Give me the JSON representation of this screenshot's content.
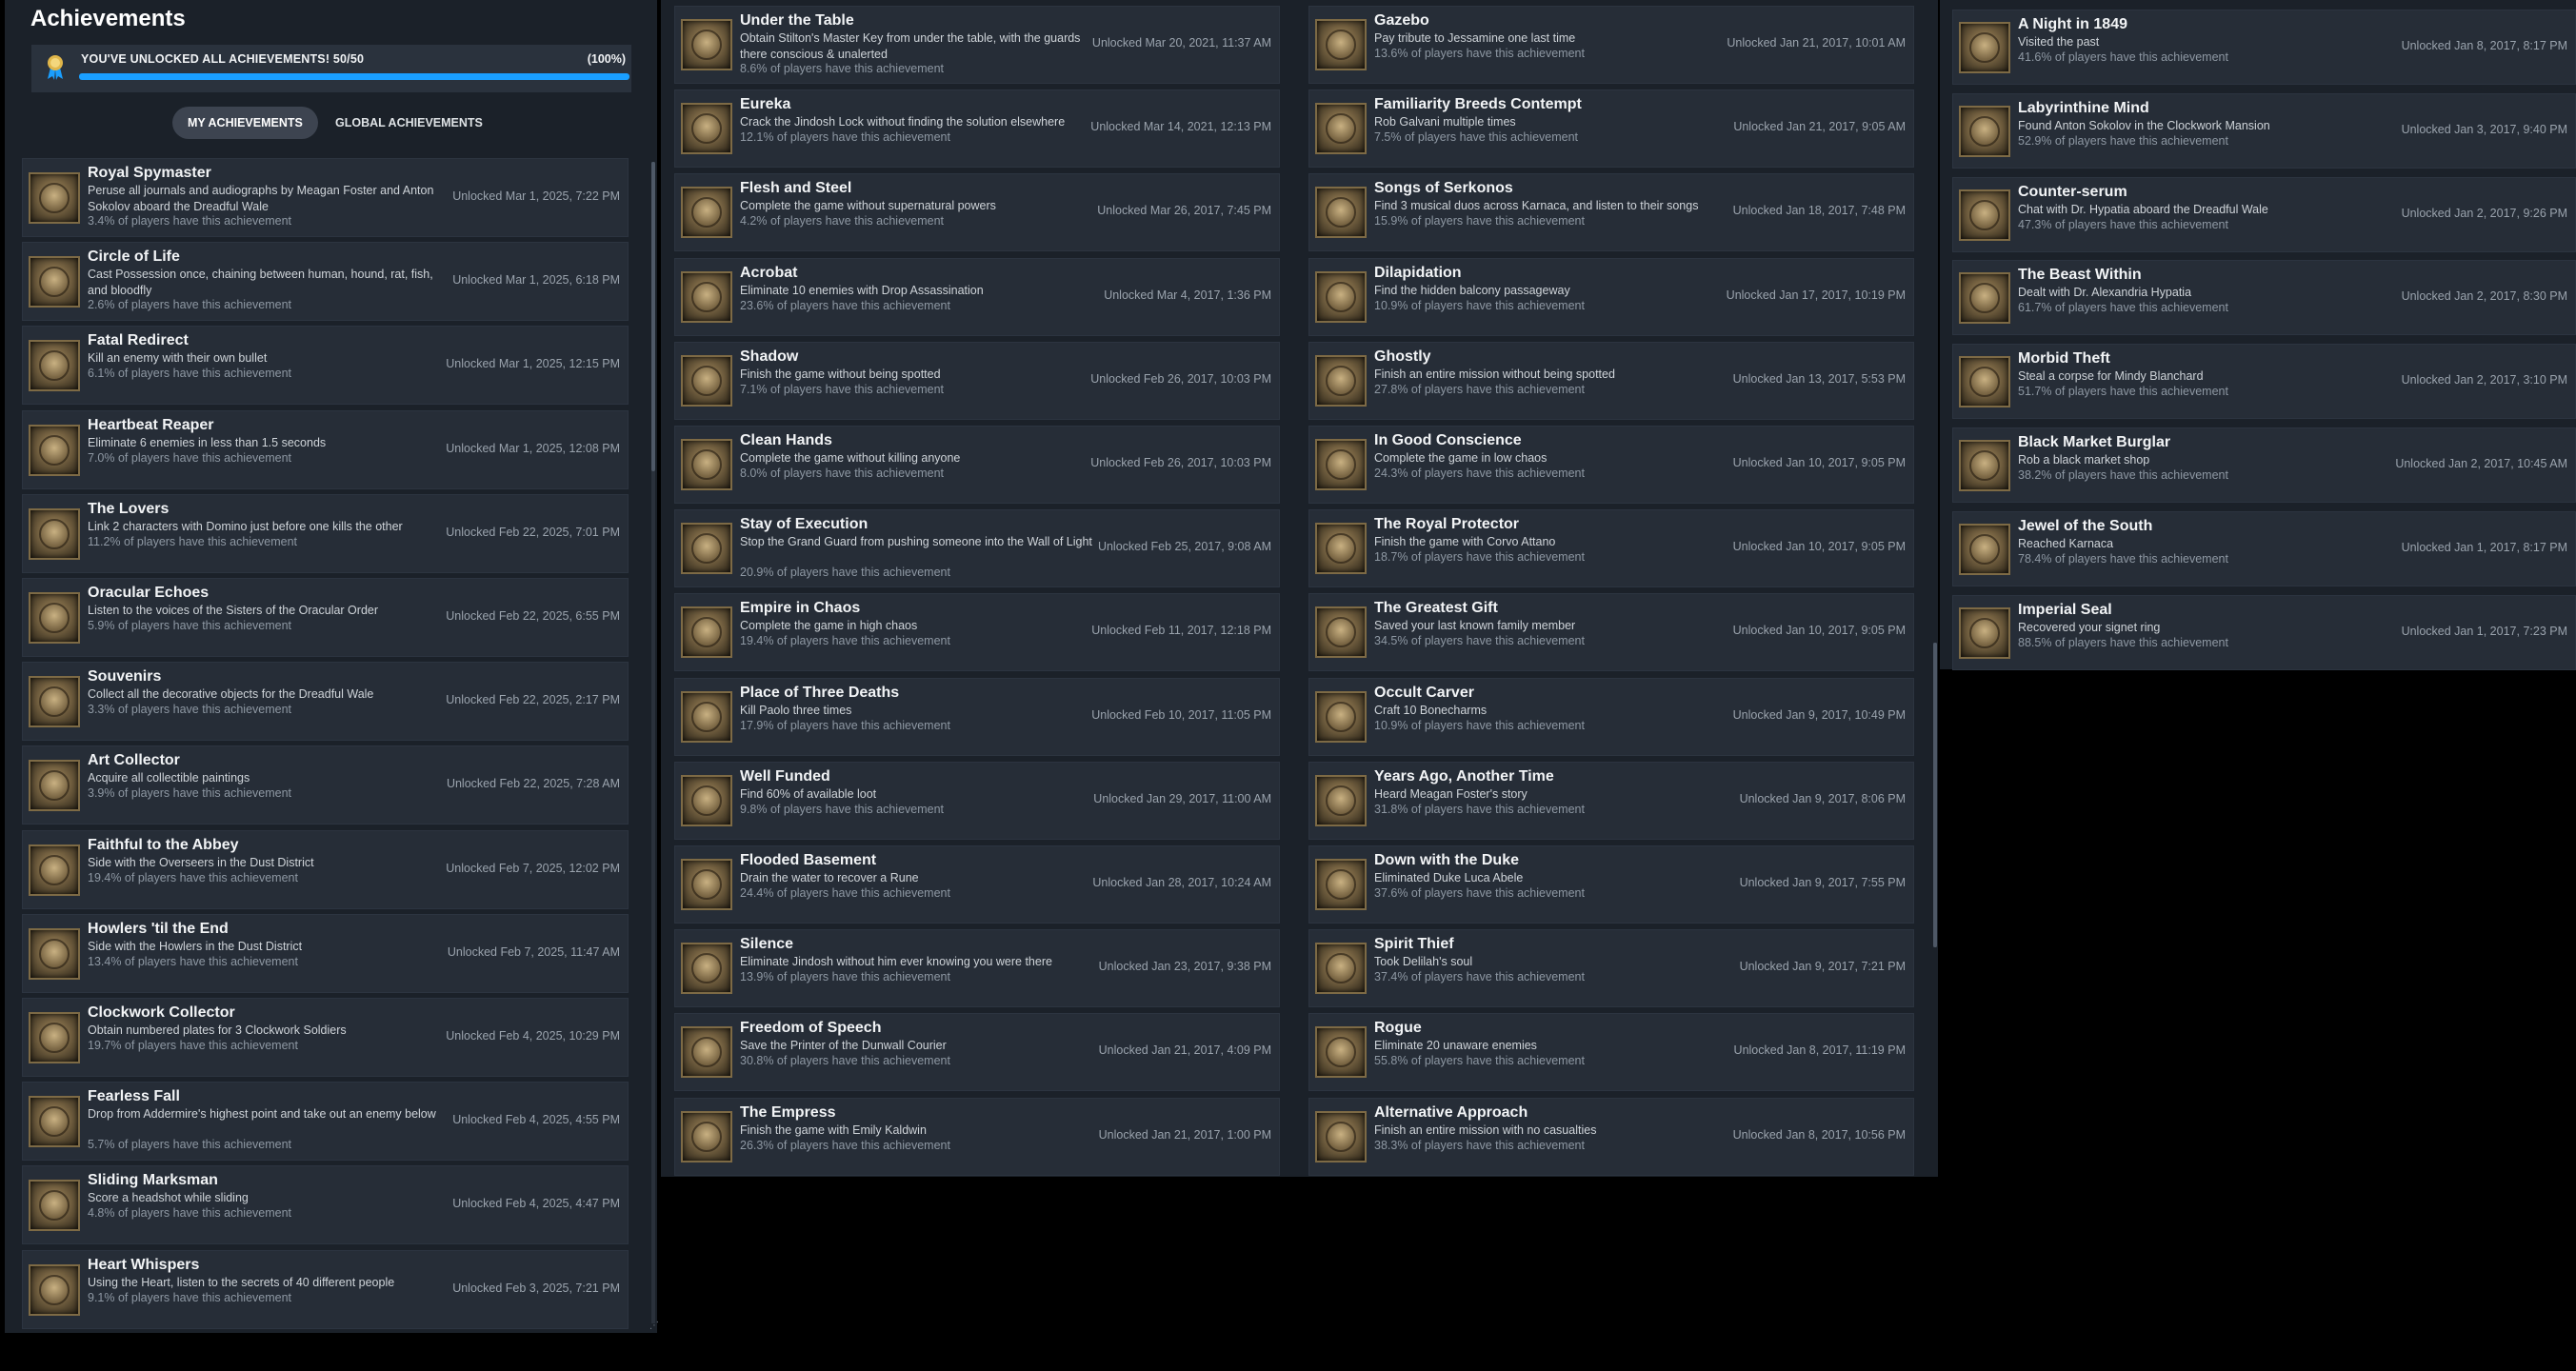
{
  "header": {
    "title": "Achievements",
    "unlock_summary": "YOU'VE UNLOCKED ALL ACHIEVEMENTS! 50/50",
    "unlock_percent": "(100%)",
    "progress_fraction": 1.0,
    "accent_color": "#1a9fff",
    "award_icon": "award-ribbon-icon"
  },
  "tabs": {
    "my": "MY ACHIEVEMENTS",
    "global": "GLOBAL ACHIEVEMENTS",
    "active": "my"
  },
  "columns": [
    [
      {
        "title": "Royal Spymaster",
        "desc": "Peruse all journals and audiographs by Meagan Foster and Anton Sokolov aboard the Dreadful Wale",
        "pct": "3.4% of players have this achievement",
        "date": "Unlocked Mar 1, 2025, 7:22 PM"
      },
      {
        "title": "Circle of Life",
        "desc": "Cast Possession once, chaining between human, hound, rat, fish, and bloodfly",
        "pct": "2.6% of players have this achievement",
        "date": "Unlocked Mar 1, 2025, 6:18 PM"
      },
      {
        "title": "Fatal Redirect",
        "desc": "Kill an enemy with their own bullet",
        "pct": "6.1% of players have this achievement",
        "date": "Unlocked Mar 1, 2025, 12:15 PM"
      },
      {
        "title": "Heartbeat Reaper",
        "desc": "Eliminate 6 enemies in less than 1.5 seconds",
        "pct": "7.0% of players have this achievement",
        "date": "Unlocked Mar 1, 2025, 12:08 PM"
      },
      {
        "title": "The Lovers",
        "desc": "Link 2 characters with Domino just before one kills the other",
        "pct": "11.2% of players have this achievement",
        "date": "Unlocked Feb 22, 2025, 7:01 PM"
      },
      {
        "title": "Oracular Echoes",
        "desc": "Listen to the voices of the Sisters of the Oracular Order",
        "pct": "5.9% of players have this achievement",
        "date": "Unlocked Feb 22, 2025, 6:55 PM"
      },
      {
        "title": "Souvenirs",
        "desc": "Collect all the decorative objects for the Dreadful Wale",
        "pct": "3.3% of players have this achievement",
        "date": "Unlocked Feb 22, 2025, 2:17 PM"
      },
      {
        "title": "Art Collector",
        "desc": "Acquire all collectible paintings",
        "pct": "3.9% of players have this achievement",
        "date": "Unlocked Feb 22, 2025, 7:28 AM"
      },
      {
        "title": "Faithful to the Abbey",
        "desc": "Side with the Overseers in the Dust District",
        "pct": "19.4% of players have this achievement",
        "date": "Unlocked Feb 7, 2025, 12:02 PM"
      },
      {
        "title": "Howlers 'til the End",
        "desc": "Side with the Howlers in the Dust District",
        "pct": "13.4% of players have this achievement",
        "date": "Unlocked Feb 7, 2025, 11:47 AM"
      },
      {
        "title": "Clockwork Collector",
        "desc": "Obtain numbered plates for 3 Clockwork Soldiers",
        "pct": "19.7% of players have this achievement",
        "date": "Unlocked Feb 4, 2025, 10:29 PM"
      },
      {
        "title": "Fearless Fall",
        "desc": "Drop from Addermire's highest point and take out an enemy below",
        "pct": "5.7% of players have this achievement",
        "date": "Unlocked Feb 4, 2025, 4:55 PM"
      },
      {
        "title": "Sliding Marksman",
        "desc": "Score a headshot while sliding",
        "pct": "4.8% of players have this achievement",
        "date": "Unlocked Feb 4, 2025, 4:47 PM"
      },
      {
        "title": "Heart Whispers",
        "desc": "Using the Heart, listen to the secrets of 40 different people",
        "pct": "9.1% of players have this achievement",
        "date": "Unlocked Feb 3, 2025, 7:21 PM"
      }
    ],
    [
      {
        "title": "Under the Table",
        "desc": "Obtain Stilton's Master Key from under the table, with the guards there conscious & unalerted",
        "pct": "8.6% of players have this achievement",
        "date": "Unlocked Mar 20, 2021, 11:37 AM"
      },
      {
        "title": "Eureka",
        "desc": "Crack the Jindosh Lock without finding the solution elsewhere",
        "pct": "12.1% of players have this achievement",
        "date": "Unlocked Mar 14, 2021, 12:13 PM"
      },
      {
        "title": "Flesh and Steel",
        "desc": "Complete the game without supernatural powers",
        "pct": "4.2% of players have this achievement",
        "date": "Unlocked Mar 26, 2017, 7:45 PM"
      },
      {
        "title": "Acrobat",
        "desc": "Eliminate 10 enemies with Drop Assassination",
        "pct": "23.6% of players have this achievement",
        "date": "Unlocked Mar 4, 2017, 1:36 PM"
      },
      {
        "title": "Shadow",
        "desc": "Finish the game without being spotted",
        "pct": "7.1% of players have this achievement",
        "date": "Unlocked Feb 26, 2017, 10:03 PM"
      },
      {
        "title": "Clean Hands",
        "desc": "Complete the game without killing anyone",
        "pct": "8.0% of players have this achievement",
        "date": "Unlocked Feb 26, 2017, 10:03 PM"
      },
      {
        "title": "Stay of Execution",
        "desc": "Stop the Grand Guard from pushing someone into the Wall of Light",
        "pct": "20.9% of players have this achievement",
        "date": "Unlocked Feb 25, 2017, 9:08 AM"
      },
      {
        "title": "Empire in Chaos",
        "desc": "Complete the game in high chaos",
        "pct": "19.4% of players have this achievement",
        "date": "Unlocked Feb 11, 2017, 12:18 PM"
      },
      {
        "title": "Place of Three Deaths",
        "desc": "Kill Paolo three times",
        "pct": "17.9% of players have this achievement",
        "date": "Unlocked Feb 10, 2017, 11:05 PM"
      },
      {
        "title": "Well Funded",
        "desc": "Find 60% of available loot",
        "pct": "9.8% of players have this achievement",
        "date": "Unlocked Jan 29, 2017, 11:00 AM"
      },
      {
        "title": "Flooded Basement",
        "desc": "Drain the water to recover a Rune",
        "pct": "24.4% of players have this achievement",
        "date": "Unlocked Jan 28, 2017, 10:24 AM"
      },
      {
        "title": "Silence",
        "desc": "Eliminate Jindosh without him ever knowing you were there",
        "pct": "13.9% of players have this achievement",
        "date": "Unlocked Jan 23, 2017, 9:38 PM"
      },
      {
        "title": "Freedom of Speech",
        "desc": "Save the Printer of the Dunwall Courier",
        "pct": "30.8% of players have this achievement",
        "date": "Unlocked Jan 21, 2017, 4:09 PM"
      },
      {
        "title": "The Empress",
        "desc": "Finish the game with Emily Kaldwin",
        "pct": "26.3% of players have this achievement",
        "date": "Unlocked Jan 21, 2017, 1:00 PM"
      }
    ],
    [
      {
        "title": "Gazebo",
        "desc": "Pay tribute to Jessamine one last time",
        "pct": "13.6% of players have this achievement",
        "date": "Unlocked Jan 21, 2017, 10:01 AM"
      },
      {
        "title": "Familiarity Breeds Contempt",
        "desc": "Rob Galvani multiple times",
        "pct": "7.5% of players have this achievement",
        "date": "Unlocked Jan 21, 2017, 9:05 AM"
      },
      {
        "title": "Songs of Serkonos",
        "desc": "Find 3 musical duos across Karnaca, and listen to their songs",
        "pct": "15.9% of players have this achievement",
        "date": "Unlocked Jan 18, 2017, 7:48 PM"
      },
      {
        "title": "Dilapidation",
        "desc": "Find the hidden balcony passageway",
        "pct": "10.9% of players have this achievement",
        "date": "Unlocked Jan 17, 2017, 10:19 PM"
      },
      {
        "title": "Ghostly",
        "desc": "Finish an entire mission without being spotted",
        "pct": "27.8% of players have this achievement",
        "date": "Unlocked Jan 13, 2017, 5:53 PM"
      },
      {
        "title": "In Good Conscience",
        "desc": "Complete the game in low chaos",
        "pct": "24.3% of players have this achievement",
        "date": "Unlocked Jan 10, 2017, 9:05 PM"
      },
      {
        "title": "The Royal Protector",
        "desc": "Finish the game with Corvo Attano",
        "pct": "18.7% of players have this achievement",
        "date": "Unlocked Jan 10, 2017, 9:05 PM"
      },
      {
        "title": "The Greatest Gift",
        "desc": "Saved your last known family member",
        "pct": "34.5% of players have this achievement",
        "date": "Unlocked Jan 10, 2017, 9:05 PM"
      },
      {
        "title": "Occult Carver",
        "desc": "Craft 10 Bonecharms",
        "pct": "10.9% of players have this achievement",
        "date": "Unlocked Jan 9, 2017, 10:49 PM"
      },
      {
        "title": "Years Ago, Another Time",
        "desc": "Heard Meagan Foster's story",
        "pct": "31.8% of players have this achievement",
        "date": "Unlocked Jan 9, 2017, 8:06 PM"
      },
      {
        "title": "Down with the Duke",
        "desc": "Eliminated Duke Luca Abele",
        "pct": "37.6% of players have this achievement",
        "date": "Unlocked Jan 9, 2017, 7:55 PM"
      },
      {
        "title": "Spirit Thief",
        "desc": "Took Delilah's soul",
        "pct": "37.4% of players have this achievement",
        "date": "Unlocked Jan 9, 2017, 7:21 PM"
      },
      {
        "title": "Rogue",
        "desc": "Eliminate 20 unaware enemies",
        "pct": "55.8% of players have this achievement",
        "date": "Unlocked Jan 8, 2017, 11:19 PM"
      },
      {
        "title": "Alternative Approach",
        "desc": "Finish an entire mission with no casualties",
        "pct": "38.3% of players have this achievement",
        "date": "Unlocked Jan 8, 2017, 10:56 PM"
      }
    ],
    [
      {
        "title": "A Night in 1849",
        "desc": "Visited the past",
        "pct": "41.6% of players have this achievement",
        "date": "Unlocked Jan 8, 2017, 8:17 PM"
      },
      {
        "title": "Labyrinthine Mind",
        "desc": "Found Anton Sokolov in the Clockwork Mansion",
        "pct": "52.9% of players have this achievement",
        "date": "Unlocked Jan 3, 2017, 9:40 PM"
      },
      {
        "title": "Counter-serum",
        "desc": "Chat with Dr. Hypatia aboard the Dreadful Wale",
        "pct": "47.3% of players have this achievement",
        "date": "Unlocked Jan 2, 2017, 9:26 PM"
      },
      {
        "title": "The Beast Within",
        "desc": "Dealt with Dr. Alexandria Hypatia",
        "pct": "61.7% of players have this achievement",
        "date": "Unlocked Jan 2, 2017, 8:30 PM"
      },
      {
        "title": "Morbid Theft",
        "desc": "Steal a corpse for Mindy Blanchard",
        "pct": "51.7% of players have this achievement",
        "date": "Unlocked Jan 2, 2017, 3:10 PM"
      },
      {
        "title": "Black Market Burglar",
        "desc": "Rob a black market shop",
        "pct": "38.2% of players have this achievement",
        "date": "Unlocked Jan 2, 2017, 10:45 AM"
      },
      {
        "title": "Jewel of the South",
        "desc": "Reached Karnaca",
        "pct": "78.4% of players have this achievement",
        "date": "Unlocked Jan 1, 2017, 8:17 PM"
      },
      {
        "title": "Imperial Seal",
        "desc": "Recovered your signet ring",
        "pct": "88.5% of players have this achievement",
        "date": "Unlocked Jan 1, 2017, 7:23 PM"
      }
    ]
  ]
}
